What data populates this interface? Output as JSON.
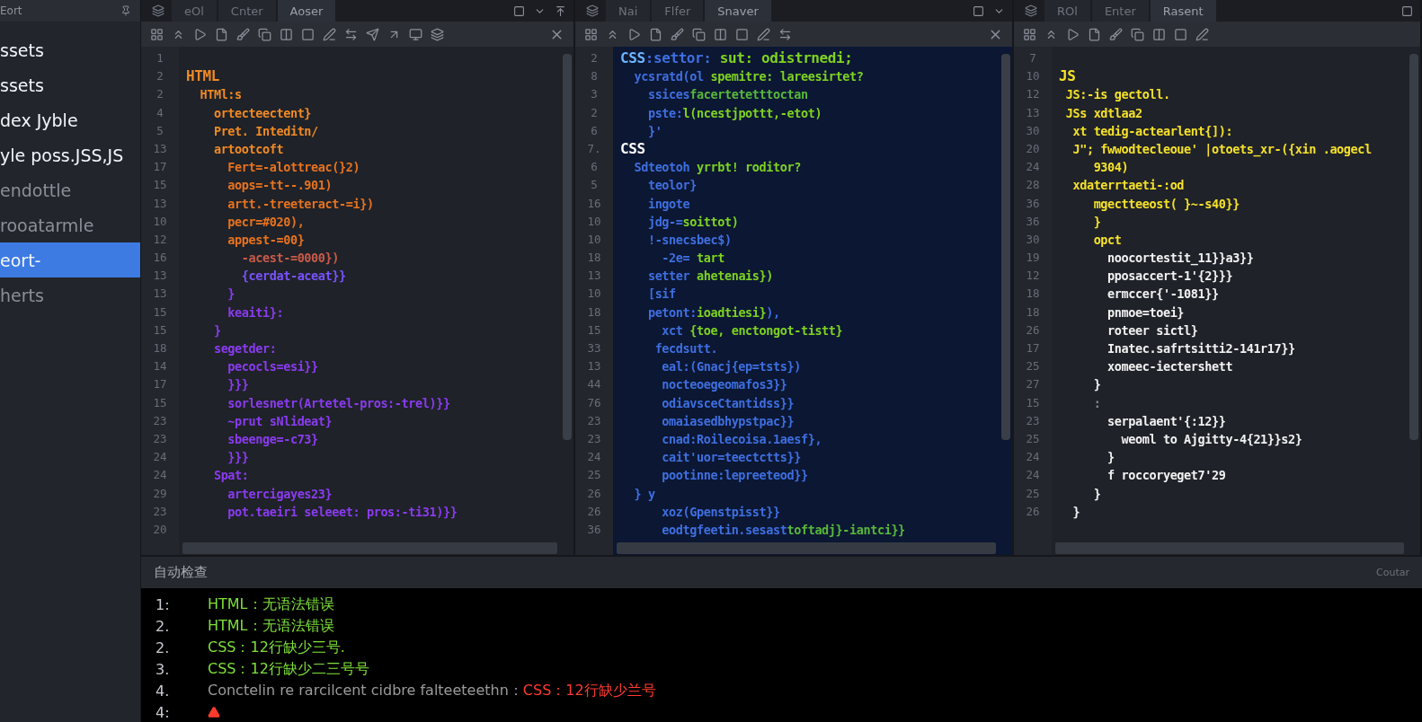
{
  "sidebar": {
    "title": "Eort",
    "items": [
      {
        "label": "ssets",
        "selected": false,
        "muted": false
      },
      {
        "label": "ssets",
        "selected": false,
        "muted": false
      },
      {
        "label": "dex Jyble",
        "selected": false,
        "muted": false
      },
      {
        "label": "yle poss.JSS,JS",
        "selected": false,
        "muted": false
      },
      {
        "label": "endottle",
        "selected": false,
        "muted": true
      },
      {
        "label": "rooatarmle",
        "selected": false,
        "muted": true
      },
      {
        "label": "eort-",
        "selected": true,
        "muted": false
      },
      {
        "label": "herts",
        "selected": false,
        "muted": true
      }
    ]
  },
  "panes": [
    {
      "kind": "dark",
      "closable": true,
      "tabs": [
        {
          "label": "eOl",
          "selected": false
        },
        {
          "label": "Cnter",
          "selected": false
        },
        {
          "label": "Aoser",
          "selected": true
        }
      ],
      "lines": [
        {
          "number": "1"
        },
        {
          "number": "2",
          "parts": [
            {
              "text": "HTML",
              "color": "#f08a24"
            }
          ]
        },
        {
          "number": "2",
          "parts": [
            {
              "text": "  HTMl:s",
              "color": "#f08a24"
            }
          ]
        },
        {
          "number": "4",
          "parts": [
            {
              "text": "    ortecteectent}",
              "color": "#f08a24"
            }
          ]
        },
        {
          "number": "5",
          "parts": [
            {
              "text": "    Pret. Inteditn/",
              "color": "#f08a24"
            }
          ]
        },
        {
          "number": "13",
          "parts": [
            {
              "text": "    artootcoft",
              "color": "#f08a24"
            }
          ]
        },
        {
          "number": "17",
          "parts": [
            {
              "text": "      Fert=-alottreac(}2)",
              "color": "#e8731f"
            }
          ]
        },
        {
          "number": "15",
          "parts": [
            {
              "text": "      aops=-tt--.901)",
              "color": "#e8731f"
            }
          ]
        },
        {
          "number": "13",
          "parts": [
            {
              "text": "      artt.-treeteract-=i})",
              "color": "#e8731f"
            }
          ]
        },
        {
          "number": "10",
          "parts": [
            {
              "text": "      pecr=#020),",
              "color": "#e8731f"
            }
          ]
        },
        {
          "number": "12",
          "parts": [
            {
              "text": "      appest-=00}",
              "color": "#e8731f"
            }
          ]
        },
        {
          "number": "16",
          "parts": [
            {
              "text": "        -acest-=0000})",
              "color": "#c95a4a"
            }
          ]
        },
        {
          "number": "13",
          "parts": [
            {
              "text": "        {cerdat-aceat}}",
              "color": "#7a52ff"
            }
          ]
        },
        {
          "number": "13",
          "parts": [
            {
              "text": "      }",
              "color": "#8a3cf0"
            }
          ]
        },
        {
          "number": "15",
          "parts": [
            {
              "text": "      keaiti}:",
              "color": "#8a3cf0"
            }
          ]
        },
        {
          "number": "15",
          "parts": [
            {
              "text": "    }",
              "color": "#8a3cf0"
            }
          ]
        },
        {
          "number": "18",
          "parts": [
            {
              "text": "    segetder:",
              "color": "#8a3cf0"
            }
          ]
        },
        {
          "number": "14",
          "parts": [
            {
              "text": "      pecocls=esi}}",
              "color": "#8a3cf0"
            }
          ]
        },
        {
          "number": "17",
          "parts": [
            {
              "text": "      }}}",
              "color": "#8a3cf0"
            }
          ]
        },
        {
          "number": "15",
          "parts": [
            {
              "text": "      sorlesnetr(Artetel-pros:-trel)}}",
              "color": "#8a3cf0"
            }
          ]
        },
        {
          "number": "23",
          "parts": [
            {
              "text": "      ~prut sNlideat}",
              "color": "#8a3cf0"
            }
          ]
        },
        {
          "number": "23",
          "parts": [
            {
              "text": "      sbeenge=-c73}",
              "color": "#8a3cf0"
            }
          ]
        },
        {
          "number": "24",
          "parts": [
            {
              "text": "      }}}",
              "color": "#8a3cf0"
            }
          ]
        },
        {
          "number": "24",
          "parts": [
            {
              "text": "    Spat:",
              "color": "#8a3cf0"
            }
          ]
        },
        {
          "number": "29",
          "parts": [
            {
              "text": "      artercigayes23}",
              "color": "#8a3cf0"
            }
          ]
        },
        {
          "number": "23",
          "parts": [
            {
              "text": "      pot.taeiri seleeet: pros:-ti31)}}",
              "color": "#8a3cf0"
            }
          ]
        }
      ],
      "last_number": "20"
    },
    {
      "kind": "navy",
      "closable": true,
      "tabs": [
        {
          "label": "Nai",
          "selected": false
        },
        {
          "label": "Flfer",
          "selected": false
        },
        {
          "label": "Snaver",
          "selected": true
        }
      ],
      "lines": [
        {
          "number": "2",
          "parts": [
            {
              "text": "CSS",
              "color": "#6fb4ff"
            },
            {
              "text": ":settor: ",
              "color": "#3f6fe0"
            },
            {
              "text": "sut: odistrnedi;",
              "color": "#7ed321"
            }
          ]
        },
        {
          "number": "8",
          "parts": [
            {
              "text": "  ycsratd(ol ",
              "color": "#3f6fe0"
            },
            {
              "text": "spemitre: lareesirtet?",
              "color": "#7ed321"
            }
          ]
        },
        {
          "number": "3",
          "parts": [
            {
              "text": "    ssices",
              "color": "#3f6fe0"
            },
            {
              "text": "facertetetttoctan",
              "color": "#58b83a"
            }
          ]
        },
        {
          "number": "2",
          "parts": [
            {
              "text": "    pste:",
              "color": "#3f6fe0"
            },
            {
              "text": "l(ncestjpottt,-etot)",
              "color": "#7ed321"
            }
          ]
        },
        {
          "number": "6",
          "parts": [
            {
              "text": "    }'",
              "color": "#3f6fe0"
            }
          ]
        },
        {
          "number": "7.",
          "parts": [
            {
              "text": "CSS",
              "color": "#ffffff"
            }
          ]
        },
        {
          "number": "6",
          "parts": [
            {
              "text": "  Sdteotoh ",
              "color": "#3f6fe0"
            },
            {
              "text": "yrrbt! roditor?",
              "color": "#7ed321"
            }
          ]
        },
        {
          "number": "5",
          "parts": [
            {
              "text": "    teolor}",
              "color": "#3f6fe0"
            }
          ]
        },
        {
          "number": "16",
          "parts": [
            {
              "text": "    ingote",
              "color": "#3f6fe0"
            }
          ]
        },
        {
          "number": "10",
          "parts": [
            {
              "text": "    jdg-=",
              "color": "#3f6fe0"
            },
            {
              "text": "soittot)",
              "color": "#7ed321"
            }
          ]
        },
        {
          "number": "10",
          "parts": [
            {
              "text": "    !-snecsbec$)",
              "color": "#3f6fe0"
            }
          ]
        },
        {
          "number": "18",
          "parts": [
            {
              "text": "      -2e= ",
              "color": "#3f6fe0"
            },
            {
              "text": "tart",
              "color": "#7ed321"
            }
          ]
        },
        {
          "number": "13",
          "parts": [
            {
              "text": "    setter ",
              "color": "#3f6fe0"
            },
            {
              "text": "ahetenais})",
              "color": "#7ed321"
            }
          ]
        },
        {
          "number": "10",
          "parts": [
            {
              "text": "    [sif",
              "color": "#3f6fe0"
            }
          ]
        },
        {
          "number": "18",
          "parts": [
            {
              "text": "    petont:",
              "color": "#3f6fe0"
            },
            {
              "text": "ioadtiesi}",
              "color": "#7ed321"
            },
            {
              "text": "),",
              "color": "#3f6fe0"
            }
          ]
        },
        {
          "number": "15",
          "parts": [
            {
              "text": "      xct ",
              "color": "#3f6fe0"
            },
            {
              "text": "{toe, enctongot-tistt}",
              "color": "#7ed321"
            }
          ]
        },
        {
          "number": "33",
          "parts": [
            {
              "text": "     fecdsutt.",
              "color": "#3f6fe0"
            }
          ]
        },
        {
          "number": "13",
          "parts": [
            {
              "text": "      eal:(Gnacj{ep=tsts})",
              "color": "#3f6fe0"
            }
          ]
        },
        {
          "number": "44",
          "parts": [
            {
              "text": "      nocteoegeomafos3}}",
              "color": "#3f6fe0"
            }
          ]
        },
        {
          "number": "76",
          "parts": [
            {
              "text": "      odiavsceCtantidss}}",
              "color": "#3f6fe0"
            }
          ]
        },
        {
          "number": "23",
          "parts": [
            {
              "text": "      omaiasedbhypstpac}}",
              "color": "#3f6fe0"
            }
          ]
        },
        {
          "number": "23",
          "parts": [
            {
              "text": "      cnad:Roilecoisa.1aesf},",
              "color": "#3f6fe0"
            }
          ]
        },
        {
          "number": "24",
          "parts": [
            {
              "text": "      cait'uor=teectctts}}",
              "color": "#3f6fe0"
            }
          ]
        },
        {
          "number": "25",
          "parts": [
            {
              "text": "      pootinne:lepreeteod}}",
              "color": "#3f6fe0"
            }
          ]
        },
        {
          "number": "26",
          "parts": [
            {
              "text": "  } y",
              "color": "#3f6fe0"
            }
          ]
        },
        {
          "number": "26",
          "parts": [
            {
              "text": "      xoz(Gpenstpisst}}",
              "color": "#3f6fe0"
            }
          ]
        },
        {
          "number": "36",
          "parts": [
            {
              "text": "      eodtgfeetin.sesast",
              "color": "#3f6fe0"
            },
            {
              "text": "toftadj}-iantci}}",
              "color": "#58b83a"
            }
          ]
        }
      ]
    },
    {
      "kind": "dark",
      "closable": false,
      "tabs": [
        {
          "label": "ROl",
          "selected": false
        },
        {
          "label": "Enter",
          "selected": false
        },
        {
          "label": "Rasent",
          "selected": true
        }
      ],
      "lines": [
        {
          "number": "7"
        },
        {
          "number": "10",
          "parts": [
            {
              "text": "JS",
              "color": "#f5e12a"
            }
          ]
        },
        {
          "number": "12",
          "parts": [
            {
              "text": " JS:-is gectoll.",
              "color": "#f5e12a"
            }
          ]
        },
        {
          "number": "13",
          "parts": [
            {
              "text": " JSs xdtlaa2",
              "color": "#f5e12a"
            }
          ]
        },
        {
          "number": "30",
          "parts": [
            {
              "text": "  xt tedig-actearlent{]):",
              "color": "#f5e12a"
            }
          ]
        },
        {
          "number": "20",
          "parts": [
            {
              "text": "  J\"; fwwodtecleoue' |otoets_xr-({xin .aogecl",
              "color": "#f5e12a"
            }
          ]
        },
        {
          "number": "24",
          "parts": [
            {
              "text": "     9304)",
              "color": "#f5e12a"
            }
          ]
        },
        {
          "number": "28",
          "parts": [
            {
              "text": "  xdaterrtaeti-:od",
              "color": "#f5e12a"
            }
          ]
        },
        {
          "number": "36",
          "parts": [
            {
              "text": "     mgectteeost( }~-s40}}",
              "color": "#f5e12a"
            }
          ]
        },
        {
          "number": "36",
          "parts": [
            {
              "text": "     }",
              "color": "#f5e12a"
            }
          ]
        },
        {
          "number": "30",
          "parts": [
            {
              "text": "     opct",
              "color": "#f5e12a"
            }
          ]
        },
        {
          "number": "19",
          "parts": [
            {
              "text": "       noocortestit_11}}a3}}",
              "color": "#f2f2f2"
            }
          ]
        },
        {
          "number": "12",
          "parts": [
            {
              "text": "       pposaccert-1'{2}}}",
              "color": "#f2f2f2"
            }
          ]
        },
        {
          "number": "18",
          "parts": [
            {
              "text": "       ermccer{'-1081}}",
              "color": "#f2f2f2"
            }
          ]
        },
        {
          "number": "18",
          "parts": [
            {
              "text": "       pnmoe=toei}",
              "color": "#f2f2f2"
            }
          ]
        },
        {
          "number": "26",
          "parts": [
            {
              "text": "       roteer sictl}",
              "color": "#f2f2f2"
            }
          ]
        },
        {
          "number": "17",
          "parts": [
            {
              "text": "       Inatec.safrtsitti2-141r17}}",
              "color": "#f2f2f2"
            }
          ]
        },
        {
          "number": "25",
          "parts": [
            {
              "text": "       xomeec-iectershett",
              "color": "#f2f2f2"
            }
          ]
        },
        {
          "number": "27",
          "parts": [
            {
              "text": "     }",
              "color": "#f2f2f2"
            }
          ]
        },
        {
          "number": "15",
          "parts": [
            {
              "text": "     :",
              "color": "#8a8a8a"
            }
          ]
        },
        {
          "number": "23",
          "parts": [
            {
              "text": "       serpalaent'{:12}}",
              "color": "#f2f2f2"
            }
          ]
        },
        {
          "number": "25",
          "parts": [
            {
              "text": "         weoml to Ajgitty-4{21}}s2}",
              "color": "#f2f2f2"
            }
          ]
        },
        {
          "number": "24",
          "parts": [
            {
              "text": "       }",
              "color": "#f2f2f2"
            }
          ]
        },
        {
          "number": "24",
          "parts": [
            {
              "text": "       f roccoryeget7'29",
              "color": "#f2f2f2"
            }
          ]
        },
        {
          "number": "25",
          "parts": [
            {
              "text": "     }",
              "color": "#f2f2f2"
            }
          ]
        },
        {
          "number": "26",
          "parts": [
            {
              "text": "  }",
              "color": "#f2f2f2"
            }
          ]
        }
      ]
    }
  ],
  "output": {
    "title": "自动检查",
    "side_label": "Coutar",
    "lines": [
      {
        "kind": "message",
        "number": "1:",
        "parts": [
          {
            "text": "HTML：无语法错误",
            "color": "#7ee03a"
          }
        ]
      },
      {
        "kind": "message",
        "number": "2.",
        "parts": [
          {
            "text": "HTML：无语法错误",
            "color": "#7ee03a"
          }
        ]
      },
      {
        "kind": "message",
        "number": "2.",
        "parts": [
          {
            "text": "CSS：12行缺少三号.",
            "color": "#7ee03a"
          }
        ]
      },
      {
        "kind": "message",
        "number": "3.",
        "parts": [
          {
            "text": "CSS：12行缺少二三号号",
            "color": "#7ee03a"
          }
        ]
      },
      {
        "kind": "message",
        "number": "4.",
        "parts": [
          {
            "text": "Conctelin re rarcilcent cidbre falteeteethn：",
            "color": "#9a9a9a"
          },
          {
            "text": "CSS：12行缺少兰号",
            "color": "#ff3b2f"
          }
        ]
      },
      {
        "kind": "warning",
        "number": "4:"
      }
    ]
  }
}
